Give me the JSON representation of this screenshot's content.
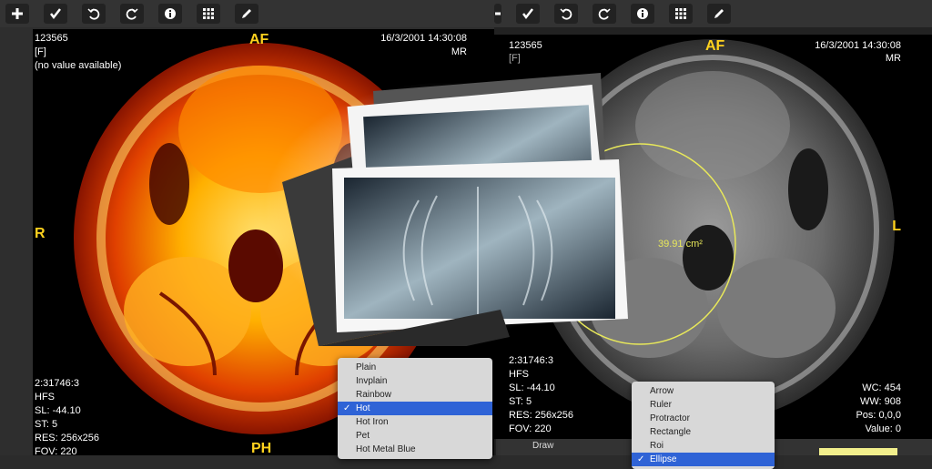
{
  "toolbar_icons": [
    "plus-icon",
    "check-icon",
    "undo-icon",
    "redo-icon",
    "info-icon",
    "grid-icon",
    "pencil-icon"
  ],
  "left": {
    "patient_id": "123565",
    "sex": "[F]",
    "no_value": "(no value available)",
    "datetime": "16/3/2001 14:30:08",
    "modality": "MR",
    "orient_top": "AF",
    "orient_left": "R",
    "orient_bottom": "PH",
    "series": "2:31746:3",
    "position": "HFS",
    "sl": "SL: -44.10",
    "st": "ST: 5",
    "res": "RES: 256x256",
    "fov": "FOV: 220"
  },
  "right": {
    "patient_id": "123565",
    "sex": "[F]",
    "datetime": "16/3/2001 14:30:08",
    "modality": "MR",
    "orient_top": "AF",
    "orient_right": "L",
    "series": "2:31746:3",
    "position": "HFS",
    "sl": "SL: -44.10",
    "st": "ST: 5",
    "res": "RES: 256x256",
    "fov": "FOV: 220",
    "wc": "WC: 454",
    "ww": "WW: 908",
    "pos": "Pos: 0,0,0",
    "value": "Value: 0",
    "measurement": "39.91 cm²"
  },
  "colormap_menu": {
    "items": [
      "Plain",
      "Invplain",
      "Rainbow",
      "Hot",
      "Hot Iron",
      "Pet",
      "Hot Metal Blue"
    ],
    "selected": "Hot"
  },
  "draw_menu": {
    "items": [
      "Arrow",
      "Ruler",
      "Protractor",
      "Rectangle",
      "Roi",
      "Ellipse"
    ],
    "selected": "Ellipse"
  },
  "bottom_label": "Draw",
  "colors": {
    "overlay_text": "#ffffff",
    "orientation": "#ffd21e",
    "measure": "#e8e85a",
    "menu_highlight": "#2f63d6"
  }
}
